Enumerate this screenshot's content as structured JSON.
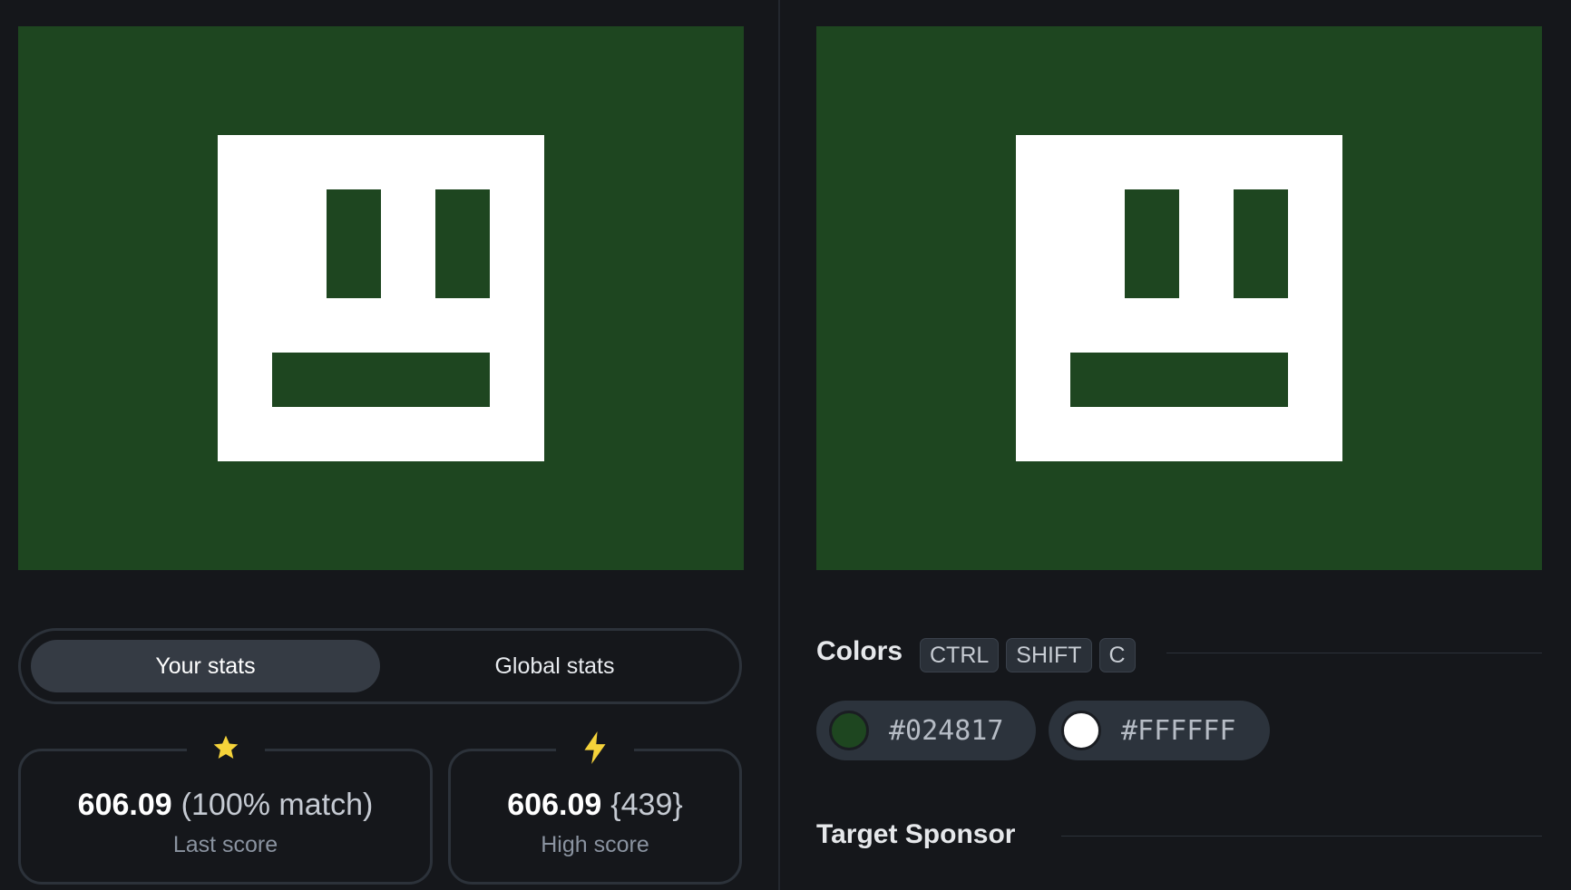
{
  "output_canvas": {
    "name": "output-canvas",
    "background": "#1e4620",
    "shape_fill": "#ffffff"
  },
  "target_canvas": {
    "name": "target-canvas",
    "background": "#1e4620",
    "shape_fill": "#ffffff"
  },
  "stats": {
    "tabs": [
      {
        "label": "Your stats",
        "active": true
      },
      {
        "label": "Global stats",
        "active": false
      }
    ],
    "last_score": {
      "icon": "star-icon",
      "icon_color": "#f5d33a",
      "value": "606.09",
      "extra": "(100% match)",
      "label": "Last score"
    },
    "high_score": {
      "icon": "lightning-icon",
      "icon_color": "#f5d33a",
      "value": "606.09",
      "extra": "{439}",
      "label": "High score"
    }
  },
  "colors_section": {
    "title": "Colors",
    "shortcut_keys": [
      "CTRL",
      "SHIFT",
      "C"
    ],
    "swatches": [
      {
        "hex": "#024817",
        "color": "#1e4620"
      },
      {
        "hex": "#FFFFFF",
        "color": "#ffffff"
      }
    ]
  },
  "sponsor_section": {
    "title": "Target Sponsor"
  }
}
